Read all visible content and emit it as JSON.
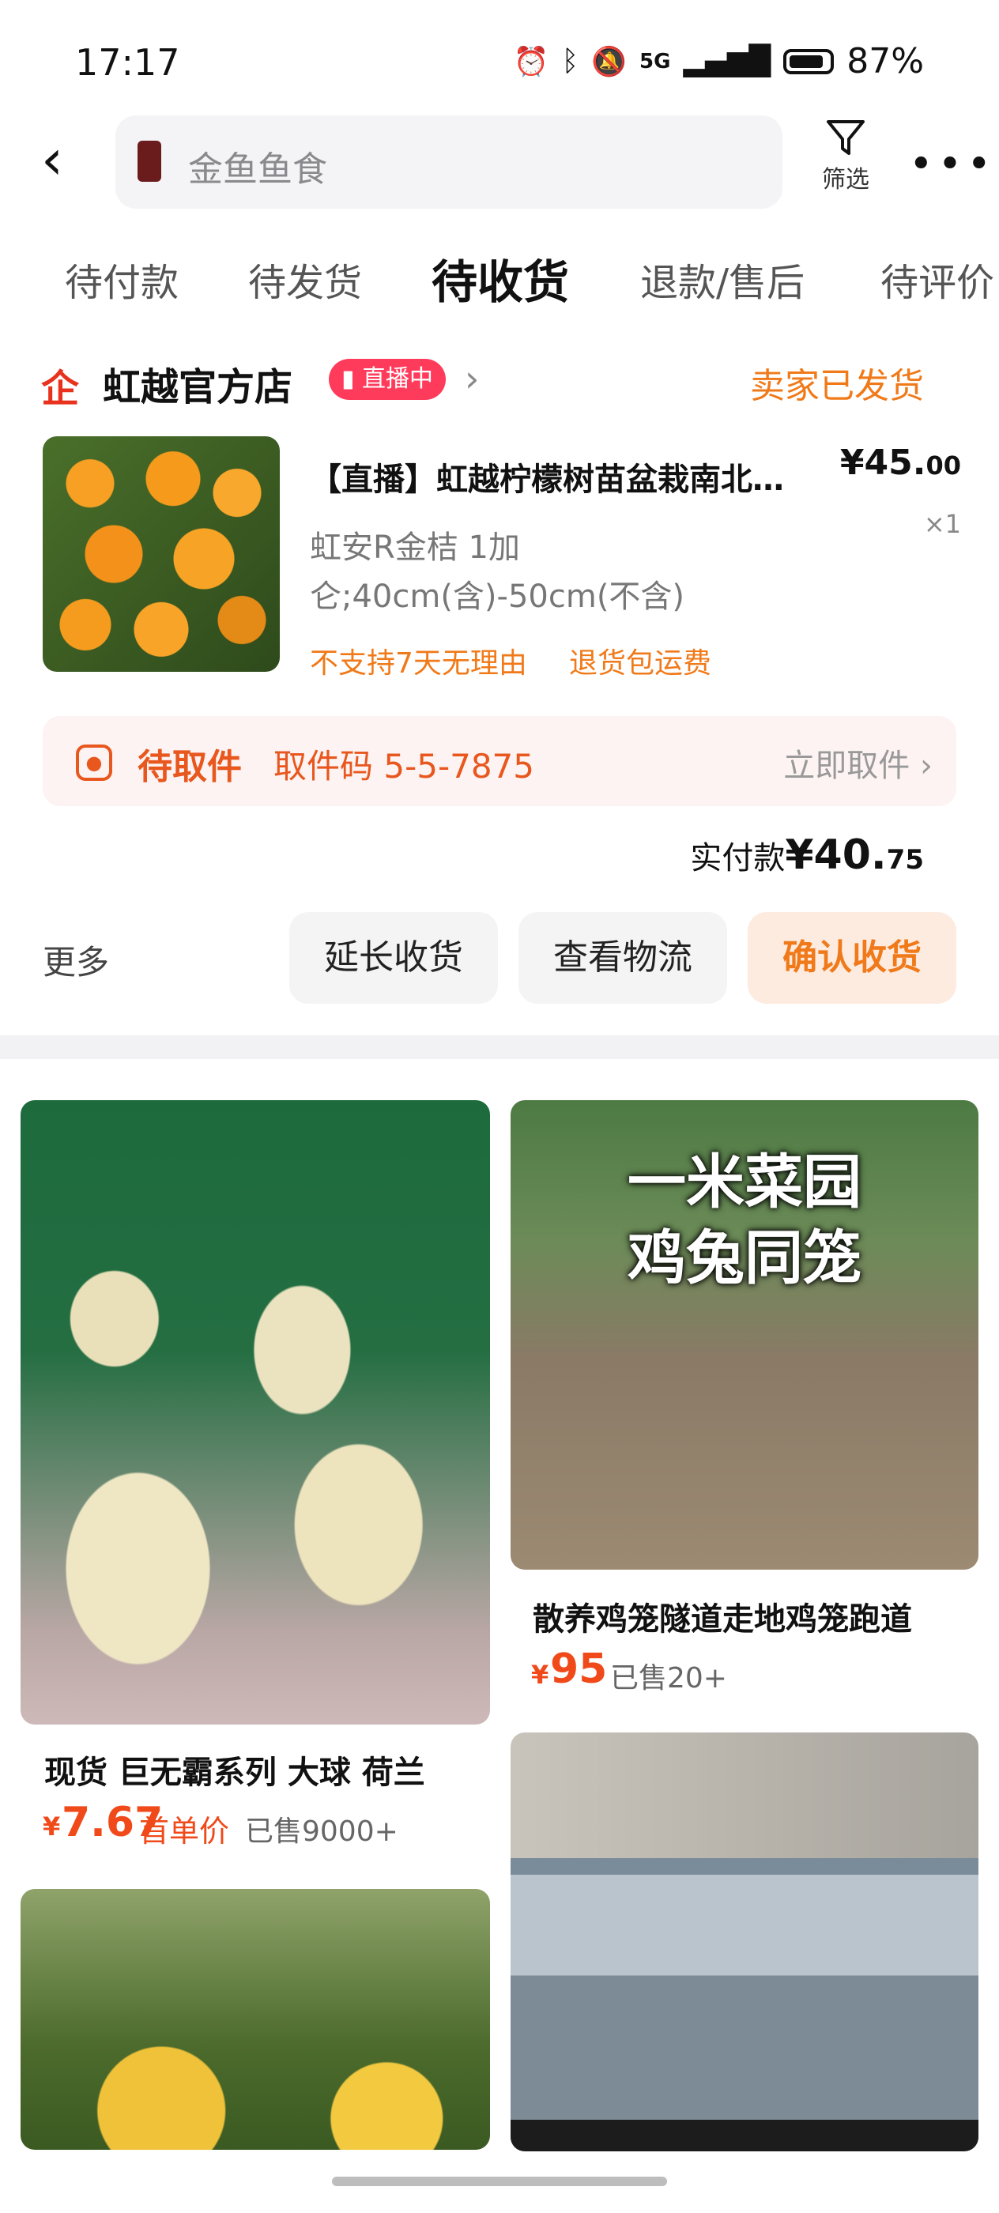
{
  "status_bar": {
    "time": "17:17",
    "network": "5G",
    "battery": "87%"
  },
  "header": {
    "search_placeholder": "金鱼鱼食",
    "filter_label": "筛选",
    "more_glyph": "•••"
  },
  "tabs": [
    {
      "label": "待付款",
      "active": false
    },
    {
      "label": "待发货",
      "active": false
    },
    {
      "label": "待收货",
      "active": true
    },
    {
      "label": "退款/售后",
      "active": false
    },
    {
      "label": "待评价",
      "active": false
    }
  ],
  "order": {
    "store_logo": "企",
    "store_name": "虹越官方店",
    "live_badge": "直播中",
    "status": "卖家已发货",
    "product_title": "【直播】虹越柠檬树苗盆栽南北…",
    "price_int": "¥45.",
    "price_dec": "00",
    "qty": "×1",
    "spec_line1": "虹安R金桔 1加",
    "spec_line2": "仑;40cm(含)-50cm(不含)",
    "tag_no_return": "不支持7天无理由",
    "tag_shipping": "退货包运费",
    "pickup": {
      "status": "待取件",
      "code": "取件码 5-5-7875",
      "action": "立即取件 ›"
    },
    "paid_label": "实付款",
    "paid_int": "¥40.",
    "paid_dec": "75",
    "more": "更多",
    "btn_extend": "延长收货",
    "btn_track": "查看物流",
    "btn_confirm": "确认收货"
  },
  "feed": [
    {
      "title": "现货 巨无霸系列 大球 荷兰",
      "price": "7.67",
      "unit": "首单价",
      "sold": "已售9000+"
    },
    {
      "overlay_line1": "一米菜园",
      "overlay_line2": "鸡兔同笼",
      "title": "散养鸡笼隧道走地鸡笼跑道",
      "price": "95",
      "sold": "已售20+"
    }
  ],
  "colors": {
    "accent": "#f07a1a",
    "price_red": "#f04a1a",
    "live_pink": "#ff3b5c",
    "logo_red": "#e8321e"
  }
}
